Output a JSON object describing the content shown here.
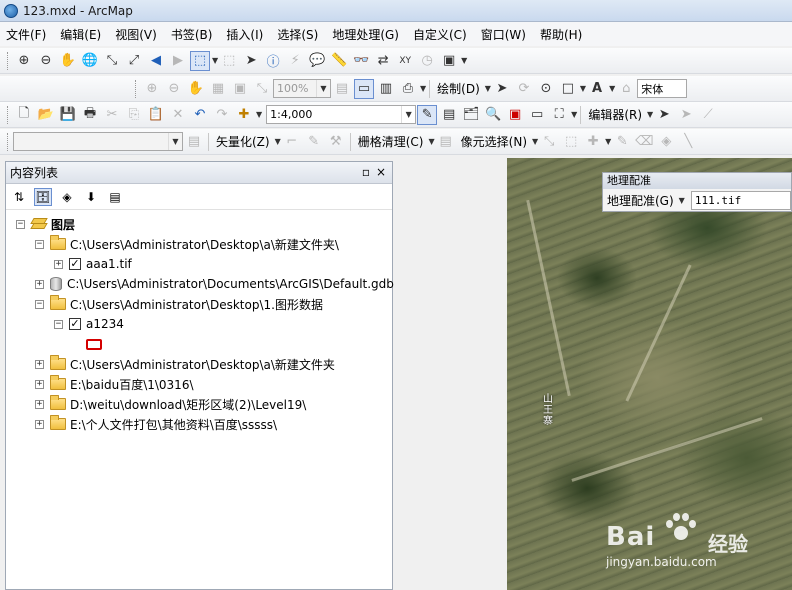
{
  "window": {
    "title": "123.mxd - ArcMap"
  },
  "menu": [
    "文件(F)",
    "编辑(E)",
    "视图(V)",
    "书签(B)",
    "插入(I)",
    "选择(S)",
    "地理处理(G)",
    "自定义(C)",
    "窗口(W)",
    "帮助(H)"
  ],
  "toolbar2": {
    "zoom_value": "100%",
    "draw_label": "绘制(D)",
    "font_value": "宋体"
  },
  "toolbar3": {
    "scale_value": "1:4,000",
    "editor_label": "编辑器(R)"
  },
  "toolbar4": {
    "vectorize_label": "矢量化(Z)",
    "raster_cleanup_label": "栅格清理(C)",
    "pixel_select_label": "像元选择(N)"
  },
  "toc": {
    "title": "内容列表",
    "pin": "▫",
    "close": "×",
    "root_label": "图层",
    "items": [
      {
        "label": "C:\\Users\\Administrator\\Desktop\\a\\新建文件夹\\"
      },
      {
        "label": "aaa1.tif"
      },
      {
        "label": "C:\\Users\\Administrator\\Documents\\ArcGIS\\Default.gdb"
      },
      {
        "label": "C:\\Users\\Administrator\\Desktop\\1.图形数据"
      },
      {
        "label": "a1234"
      },
      {
        "label": "C:\\Users\\Administrator\\Desktop\\a\\新建文件夹"
      },
      {
        "label": "E:\\baidu百度\\1\\0316\\"
      },
      {
        "label": "D:\\weitu\\download\\矩形区域(2)\\Level19\\"
      },
      {
        "label": "E:\\个人文件打包\\其他资料\\百度\\sssss\\"
      }
    ]
  },
  "georef": {
    "caption": "地理配准",
    "menu_label": "地理配准(G)",
    "layer_value": "111.tif"
  },
  "map": {
    "place_label": "山王寨"
  },
  "watermark": {
    "brand": "Bai",
    "brand2": "经验",
    "url": "jingyan.baidu.com"
  },
  "colors": {
    "symbol_outline": "#d40000",
    "title_bar": "#c9d9ee"
  }
}
